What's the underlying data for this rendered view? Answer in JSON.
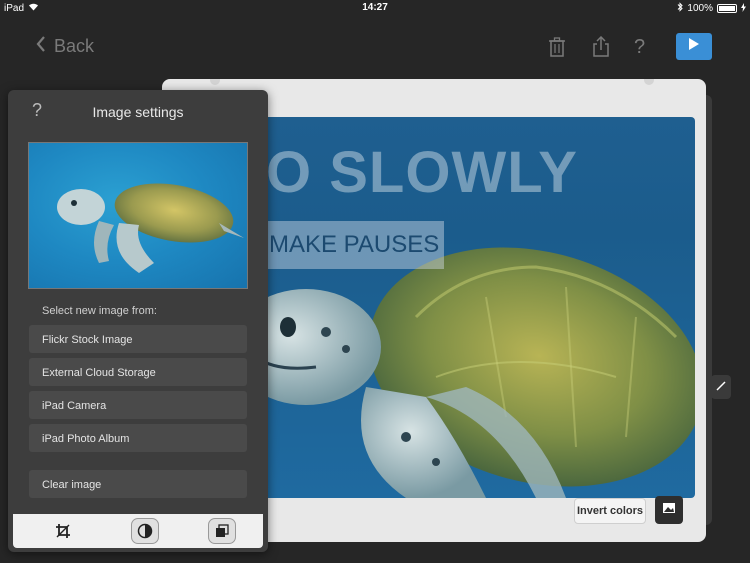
{
  "status_bar": {
    "device": "iPad",
    "time": "14:27",
    "battery": "100%"
  },
  "nav": {
    "back_label": "Back"
  },
  "toolbar": {
    "icons": [
      "trash-icon",
      "share-icon",
      "help-icon",
      "play-icon"
    ]
  },
  "slide": {
    "headline": "O SLOWLY",
    "subtitle": "MAKE PAUSES",
    "invert_colors_label": "Invert colors"
  },
  "image_settings": {
    "help_label": "?",
    "title": "Image settings",
    "select_label": "Select new image from:",
    "options": [
      {
        "label": "Flickr Stock Image"
      },
      {
        "label": "External Cloud Storage"
      },
      {
        "label": "iPad Camera"
      },
      {
        "label": "iPad Photo Album"
      }
    ],
    "clear_label": "Clear image",
    "tools": [
      "crop-icon",
      "contrast-icon",
      "layers-icon"
    ]
  },
  "colors": {
    "background": "#262626",
    "accent": "#3a8fd6",
    "panel": "#3d3d3d"
  }
}
